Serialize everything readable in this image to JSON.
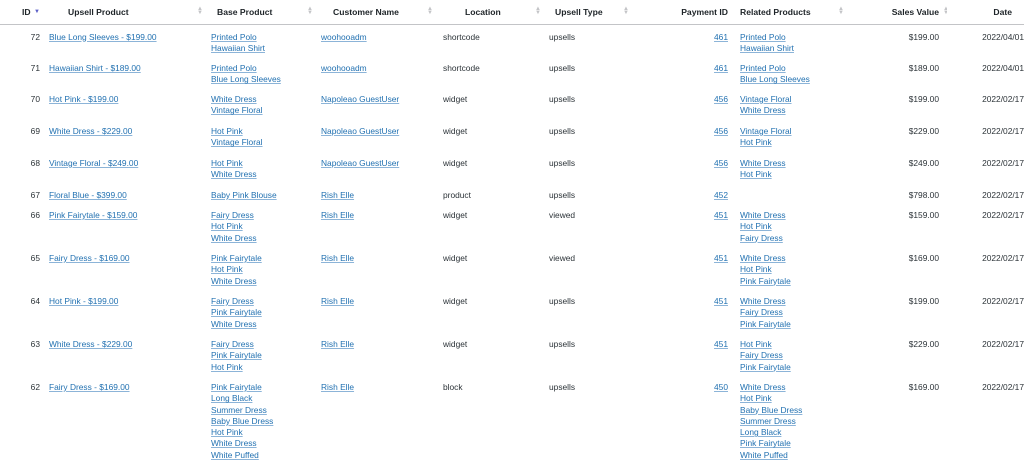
{
  "columns": {
    "id": "ID",
    "upsell_product": "Upsell Product",
    "base_product": "Base Product",
    "customer_name": "Customer Name",
    "location": "Location",
    "upsell_type": "Upsell Type",
    "payment_id": "Payment ID",
    "related_products": "Related Products",
    "sales_value": "Sales Value",
    "date": "Date"
  },
  "rows": [
    {
      "id": "72",
      "upsell": "Blue Long Sleeves - $199.00",
      "base": [
        "Printed Polo",
        "Hawaiian Shirt"
      ],
      "customer": "woohooadm",
      "location": "shortcode",
      "type": "upsells",
      "payment": "461",
      "related": [
        "Printed Polo",
        "Hawaiian Shirt"
      ],
      "value": "$199.00",
      "date": "2022/04/01"
    },
    {
      "id": "71",
      "upsell": "Hawaiian Shirt - $189.00",
      "base": [
        "Printed Polo",
        "Blue Long Sleeves"
      ],
      "customer": "woohooadm",
      "location": "shortcode",
      "type": "upsells",
      "payment": "461",
      "related": [
        "Printed Polo",
        "Blue Long Sleeves"
      ],
      "value": "$189.00",
      "date": "2022/04/01"
    },
    {
      "id": "70",
      "upsell": "Hot Pink - $199.00",
      "base": [
        "White Dress",
        "Vintage Floral"
      ],
      "customer": "Napoleao GuestUser",
      "location": "widget",
      "type": "upsells",
      "payment": "456",
      "related": [
        "Vintage Floral",
        "White Dress"
      ],
      "value": "$199.00",
      "date": "2022/02/17"
    },
    {
      "id": "69",
      "upsell": "White Dress - $229.00",
      "base": [
        "Hot Pink",
        "Vintage Floral"
      ],
      "customer": "Napoleao GuestUser",
      "location": "widget",
      "type": "upsells",
      "payment": "456",
      "related": [
        "Vintage Floral",
        "Hot Pink"
      ],
      "value": "$229.00",
      "date": "2022/02/17"
    },
    {
      "id": "68",
      "upsell": "Vintage Floral - $249.00",
      "base": [
        "Hot Pink",
        "White Dress"
      ],
      "customer": "Napoleao GuestUser",
      "location": "widget",
      "type": "upsells",
      "payment": "456",
      "related": [
        "White Dress",
        "Hot Pink"
      ],
      "value": "$249.00",
      "date": "2022/02/17"
    },
    {
      "id": "67",
      "upsell": "Floral Blue - $399.00",
      "base": [
        "Baby Pink Blouse"
      ],
      "customer": "Rish Elle",
      "location": "product",
      "type": "upsells",
      "payment": "452",
      "related": [],
      "value": "$798.00",
      "date": "2022/02/17"
    },
    {
      "id": "66",
      "upsell": "Pink Fairytale - $159.00",
      "base": [
        "Fairy Dress",
        "Hot Pink",
        "White Dress"
      ],
      "customer": "Rish Elle",
      "location": "widget",
      "type": "viewed",
      "payment": "451",
      "related": [
        "White Dress",
        "Hot Pink",
        "Fairy Dress"
      ],
      "value": "$159.00",
      "date": "2022/02/17"
    },
    {
      "id": "65",
      "upsell": "Fairy Dress - $169.00",
      "base": [
        "Pink Fairytale",
        "Hot Pink",
        "White Dress"
      ],
      "customer": "Rish Elle",
      "location": "widget",
      "type": "viewed",
      "payment": "451",
      "related": [
        "White Dress",
        "Hot Pink",
        "Pink Fairytale"
      ],
      "value": "$169.00",
      "date": "2022/02/17"
    },
    {
      "id": "64",
      "upsell": "Hot Pink - $199.00",
      "base": [
        "Fairy Dress",
        "Pink Fairytale",
        "White Dress"
      ],
      "customer": "Rish Elle",
      "location": "widget",
      "type": "upsells",
      "payment": "451",
      "related": [
        "White Dress",
        "Fairy Dress",
        "Pink Fairytale"
      ],
      "value": "$199.00",
      "date": "2022/02/17"
    },
    {
      "id": "63",
      "upsell": "White Dress - $229.00",
      "base": [
        "Fairy Dress",
        "Pink Fairytale",
        "Hot Pink"
      ],
      "customer": "Rish Elle",
      "location": "widget",
      "type": "upsells",
      "payment": "451",
      "related": [
        "Hot Pink",
        "Fairy Dress",
        "Pink Fairytale"
      ],
      "value": "$229.00",
      "date": "2022/02/17"
    },
    {
      "id": "62",
      "upsell": "Fairy Dress - $169.00",
      "base": [
        "Pink Fairytale",
        "Long Black",
        "Summer Dress",
        "Baby Blue Dress",
        "Hot Pink",
        "White Dress",
        "White Puffed"
      ],
      "customer": "Rish Elle",
      "location": "block",
      "type": "upsells",
      "payment": "450",
      "related": [
        "White Dress",
        "Hot Pink",
        "Baby Blue Dress",
        "Summer Dress",
        "Long Black",
        "Pink Fairytale",
        "White Puffed"
      ],
      "value": "$169.00",
      "date": "2022/02/17"
    }
  ]
}
